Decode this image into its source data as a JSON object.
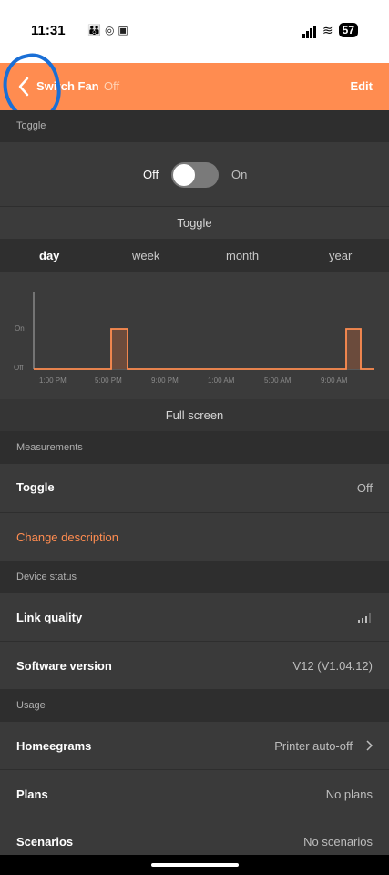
{
  "status_bar": {
    "time": "11:31",
    "battery": "57"
  },
  "header": {
    "title": "Switch Fan",
    "status": "Off",
    "edit_label": "Edit"
  },
  "toggle_section": {
    "header": "Toggle",
    "off_label": "Off",
    "on_label": "On",
    "state": "off",
    "toggle_label": "Toggle"
  },
  "tabs": [
    "day",
    "week",
    "month",
    "year"
  ],
  "chart_data": {
    "type": "line",
    "x_ticks": [
      "1:00 PM",
      "5:00 PM",
      "9:00 PM",
      "1:00 AM",
      "5:00 AM",
      "9:00 AM"
    ],
    "y_ticks": [
      "Off",
      "On"
    ],
    "series": [
      {
        "values": [
          [
            "12:00",
            0
          ],
          [
            "17:00",
            0
          ],
          [
            "17:00",
            1
          ],
          [
            "18:00",
            1
          ],
          [
            "18:00",
            0
          ],
          [
            "9:00",
            0
          ],
          [
            "9:00",
            1
          ],
          [
            "10:00",
            1
          ],
          [
            "10:00",
            0
          ],
          [
            "11:00",
            0
          ]
        ]
      }
    ],
    "color": "#ff8c50"
  },
  "full_screen_label": "Full screen",
  "measurements": {
    "header": "Measurements",
    "toggle_label": "Toggle",
    "toggle_value": "Off"
  },
  "change_description": "Change description",
  "device_status": {
    "header": "Device status",
    "link_quality_label": "Link quality",
    "software_version_label": "Software version",
    "software_version_value": "V12 (V1.04.12)"
  },
  "usage": {
    "header": "Usage",
    "homeegrams_label": "Homeegrams",
    "homeegrams_value": "Printer auto-off",
    "plans_label": "Plans",
    "plans_value": "No plans",
    "scenarios_label": "Scenarios",
    "scenarios_value": "No scenarios"
  }
}
